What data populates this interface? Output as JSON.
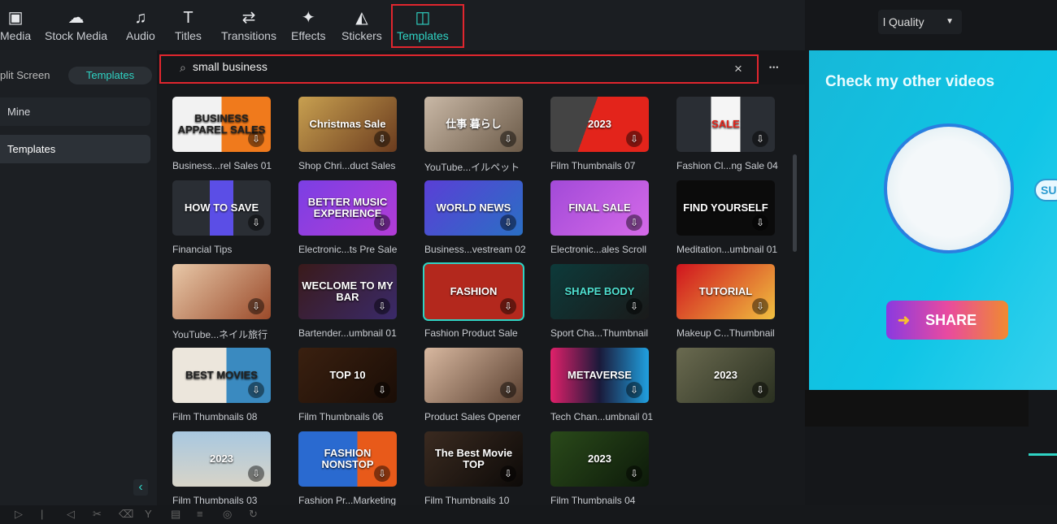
{
  "toolbar": {
    "tabs": [
      {
        "label": "Media",
        "icon": "media-icon",
        "glyph": "▣"
      },
      {
        "label": "Stock Media",
        "icon": "stock-media-icon",
        "glyph": "☁"
      },
      {
        "label": "Audio",
        "icon": "music-note-icon",
        "glyph": "♫"
      },
      {
        "label": "Titles",
        "icon": "text-t-icon",
        "glyph": "T"
      },
      {
        "label": "Transitions",
        "icon": "transitions-icon",
        "glyph": "⇄"
      },
      {
        "label": "Effects",
        "icon": "sparkle-star-icon",
        "glyph": "✦"
      },
      {
        "label": "Stickers",
        "icon": "sticker-icon",
        "glyph": "◭"
      },
      {
        "label": "Templates",
        "icon": "templates-layout-icon",
        "glyph": "◫"
      }
    ],
    "active": "Templates",
    "quality": "l Quality"
  },
  "sidebar": {
    "pills": [
      "plit Screen",
      "Templates"
    ],
    "items": [
      "Mine",
      "Templates"
    ],
    "collapse_glyph": "‹"
  },
  "search": {
    "value": "small business",
    "clear_glyph": "×",
    "more_glyph": "•••",
    "search_glyph": "⌕"
  },
  "templates": [
    {
      "label": "Business...rel Sales 01",
      "text": "BUSINESS APPAREL SALES",
      "bg": "linear-gradient(90deg,#f2f2f2 50%,#f07a1c 50%)",
      "color": "#222"
    },
    {
      "label": "Shop Chri...duct Sales",
      "text": "Christmas Sale",
      "bg": "linear-gradient(135deg,#c8a050,#6a3b1e)"
    },
    {
      "label": "YouTube...イルペット",
      "text": "仕事 暮らし",
      "bg": "linear-gradient(135deg,#c9b8a6,#6b5a48)"
    },
    {
      "label": "Film Thumbnails 07",
      "text": "2023",
      "bg": "linear-gradient(110deg,#444 40%,#e3241b 40%)"
    },
    {
      "label": "Fashion Cl...ng Sale 04",
      "text": "SALE",
      "bg": "linear-gradient(90deg,#2a2e34 35%,#f5f5f5 35%,#f5f5f5 65%,#2a2e34 65%)",
      "color": "#e3241b"
    },
    {
      "label": "Financial Tips",
      "text": "HOW TO SAVE",
      "bg": "linear-gradient(90deg,#2a2e34 38%,#5b4ee6 38%,#5b4ee6 62%,#2a2e34 62%)"
    },
    {
      "label": "Electronic...ts Pre Sale",
      "text": "BETTER MUSIC EXPERIENCE",
      "bg": "linear-gradient(135deg,#7b3fe4,#b23cd6)"
    },
    {
      "label": "Business...vestream 02",
      "text": "WORLD NEWS",
      "bg": "linear-gradient(135deg,#5a3fd6,#2a6fc4)"
    },
    {
      "label": "Electronic...ales Scroll",
      "text": "FINAL SALE",
      "bg": "linear-gradient(135deg,#a24ad8,#d56ae8)"
    },
    {
      "label": "Meditation...umbnail 01",
      "text": "FIND YOURSELF",
      "bg": "#0b0b0b"
    },
    {
      "label": "YouTube...ネイル旅行",
      "text": "",
      "bg": "linear-gradient(135deg,#e8c8a8,#9a4a2a)"
    },
    {
      "label": "Bartender...umbnail 01",
      "text": "WECLOME TO MY BAR",
      "bg": "linear-gradient(135deg,#3a1a1a,#3a2a6a)"
    },
    {
      "label": "Fashion Product Sale",
      "text": "FASHION",
      "bg": "#b3281d",
      "selected": true
    },
    {
      "label": "Sport Cha...Thumbnail",
      "text": "SHAPE BODY",
      "bg": "linear-gradient(135deg,#0d3a3a,#1a1a1a)",
      "color": "#4fe0d0"
    },
    {
      "label": "Makeup C...Thumbnail",
      "text": "TUTORIAL",
      "bg": "linear-gradient(135deg,#d0141e,#f0c040)"
    },
    {
      "label": "Film Thumbnails 08",
      "text": "BEST MOVIES",
      "bg": "linear-gradient(90deg,#ece6dc 55%,#3a8ac0 55%)",
      "color": "#222"
    },
    {
      "label": "Film Thumbnails 06",
      "text": "TOP 10",
      "bg": "linear-gradient(135deg,#3a2010,#1a0d06)"
    },
    {
      "label": "Product Sales Opener",
      "text": "",
      "bg": "linear-gradient(135deg,#d8b8a0,#5a4030)"
    },
    {
      "label": "Tech Chan...umbnail 01",
      "text": "METAVERSE",
      "bg": "linear-gradient(90deg,#e0206a,#1a1a3a 50%,#20a0e0)"
    },
    {
      "label": "",
      "text": "2023",
      "bg": "linear-gradient(135deg,#6a6a50,#2a3020)"
    },
    {
      "label": "Film Thumbnails 03",
      "text": "2023",
      "bg": "linear-gradient(180deg,#a8c8e0,#d8d4c8)"
    },
    {
      "label": "Fashion Pr...Marketing",
      "text": "FASHION NONSTOP",
      "bg": "linear-gradient(90deg,#2a6ad0 60%,#e85a1a 60%)"
    },
    {
      "label": "Film Thumbnails 10",
      "text": "The Best Movie TOP",
      "bg": "linear-gradient(135deg,#3a2a20,#0d0a08)"
    },
    {
      "label": "Film Thumbnails 04",
      "text": "2023",
      "bg": "linear-gradient(135deg,#2a4a1a,#0d1a0a)"
    }
  ],
  "preview": {
    "title": "Check my other videos",
    "share": "SHARE",
    "side_button": "SU"
  },
  "bottom": {
    "glyphs": [
      "▷",
      "|",
      "◁",
      "✂",
      "⌫",
      "Y",
      "▤",
      "≡",
      "◎",
      "↻"
    ]
  }
}
